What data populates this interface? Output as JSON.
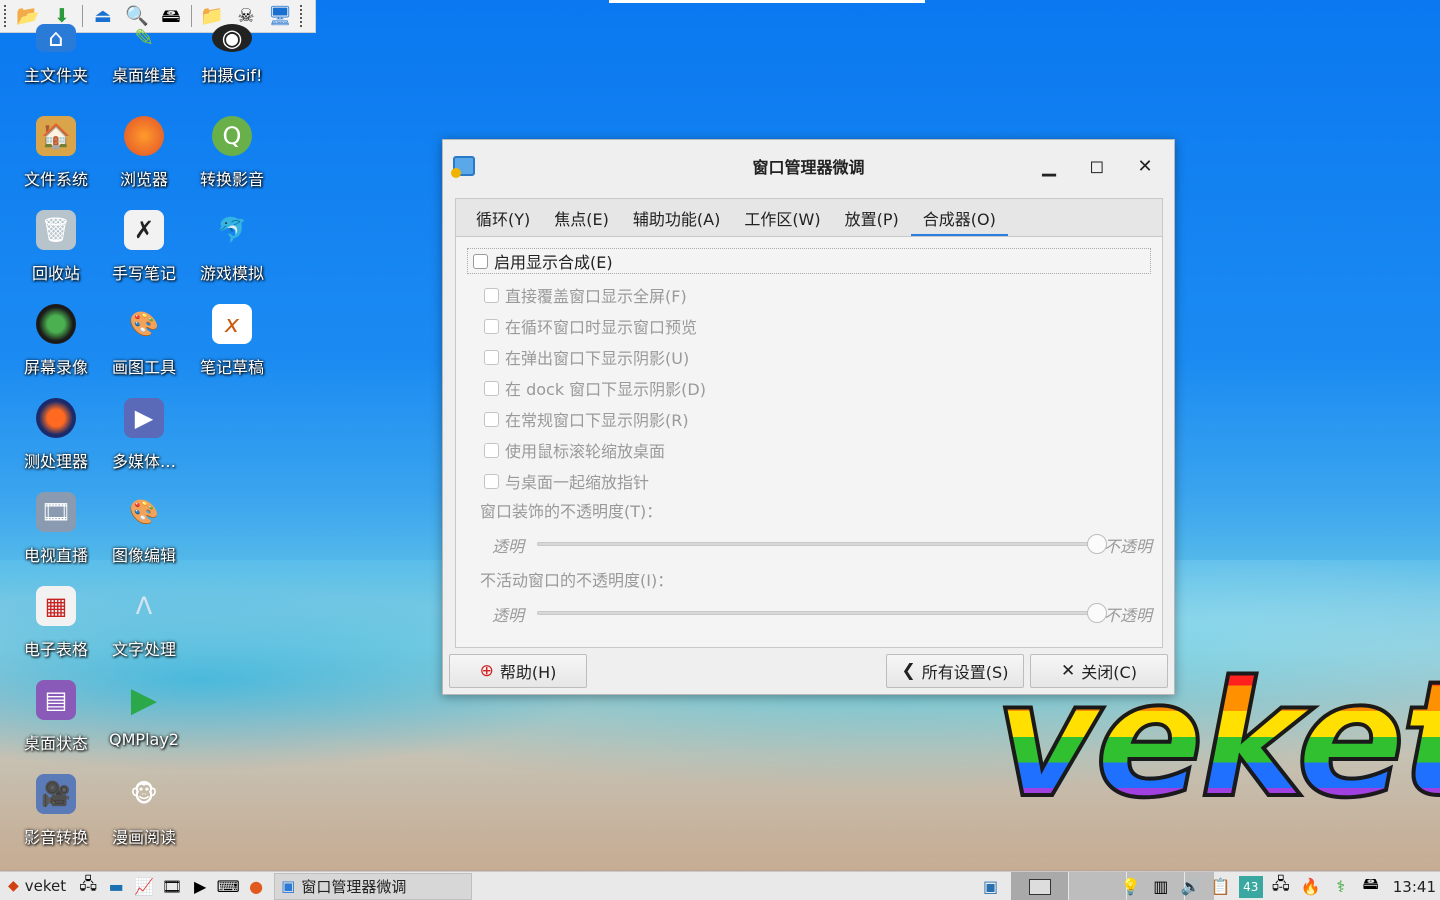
{
  "launch_bar": {
    "items": [
      "folder-icon",
      "download-icon",
      "eject-icon",
      "search-icon",
      "drive-icon",
      "files-icon",
      "skull-icon",
      "monitor-icon"
    ]
  },
  "desktop": {
    "icons": [
      {
        "label": "主文件夹",
        "icon": "home-folder-icon"
      },
      {
        "label": "桌面维基",
        "icon": "wiki-icon"
      },
      {
        "label": "拍摄Gif!",
        "icon": "camera-icon"
      },
      {
        "label": "文件系统",
        "icon": "filesystem-icon"
      },
      {
        "label": "浏览器",
        "icon": "firefox-icon"
      },
      {
        "label": "转换影音",
        "icon": "converter-icon"
      },
      {
        "label": "回收站",
        "icon": "trash-icon"
      },
      {
        "label": "手写笔记",
        "icon": "handwriting-icon"
      },
      {
        "label": "游戏模拟",
        "icon": "dolphin-icon"
      },
      {
        "label": "屏幕录像",
        "icon": "screen-recorder-icon"
      },
      {
        "label": "画图工具",
        "icon": "paint-icon"
      },
      {
        "label": "笔记草稿",
        "icon": "notes-icon"
      },
      {
        "label": "测处理器",
        "icon": "cpu-test-icon"
      },
      {
        "label": "多媒体…",
        "icon": "multimedia-icon"
      },
      {
        "label": "电视直播",
        "icon": "tv-icon"
      },
      {
        "label": "图像编辑",
        "icon": "image-editor-icon"
      },
      {
        "label": "电子表格",
        "icon": "spreadsheet-icon"
      },
      {
        "label": "文字处理",
        "icon": "word-processor-icon"
      },
      {
        "label": "桌面状态",
        "icon": "desktop-status-icon"
      },
      {
        "label": "QMPlay2",
        "icon": "qmplay-icon"
      },
      {
        "label": "影音转换",
        "icon": "video-convert-icon"
      },
      {
        "label": "漫画阅读",
        "icon": "comic-reader-icon"
      }
    ]
  },
  "window": {
    "title": "窗口管理器微调",
    "tabs": [
      "循环(Y)",
      "焦点(E)",
      "辅助功能(A)",
      "工作区(W)",
      "放置(P)",
      "合成器(O)"
    ],
    "active_tab": "合成器(O)",
    "enable_compositing": "启用显示合成(E)",
    "options": [
      "直接覆盖窗口显示全屏(F)",
      "在循环窗口时显示窗口预览",
      "在弹出窗口下显示阴影(U)",
      "在 dock 窗口下显示阴影(D)",
      "在常规窗口下显示阴影(R)",
      "使用鼠标滚轮缩放桌面",
      "与桌面一起缩放指针"
    ],
    "decor_opacity_label": "窗口装饰的不透明度(T)：",
    "inactive_opacity_label": "不活动窗口的不透明度(I)：",
    "slider_min": "透明",
    "slider_max": "不透明",
    "decor_opacity_value": 1.0,
    "inactive_opacity_value": 1.0,
    "help_button": "帮助(H)",
    "all_settings_button": "所有设置(S)",
    "close_button": "关闭(C)"
  },
  "logo": "veket",
  "taskbar": {
    "start_label": "veket",
    "task_title": "窗口管理器微调",
    "tray_badge": "43",
    "clock": "13:41"
  },
  "colors": {
    "accent": "#2b7fe0",
    "desktop_top": "#0a78f0"
  }
}
